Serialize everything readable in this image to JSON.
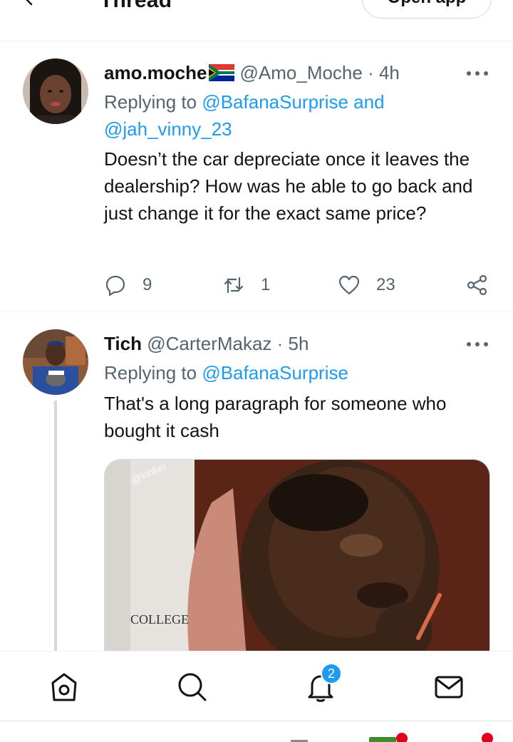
{
  "header": {
    "title": "Thread",
    "open_app_label": "Open app"
  },
  "tweets": [
    {
      "display_name": "amo.moche",
      "handle": "@Amo_Moche · 4h",
      "reply_prefix": "Replying to",
      "reply_mentions": "@BafanaSurprise and @jah_vinny_23",
      "text": "Doesn’t the car depreciate once it leaves the dealership? How was he able to go back and just change it for the exact same price?",
      "replies": "9",
      "retweets": "1",
      "likes": "23"
    },
    {
      "display_name": "Tich",
      "handle": "@CarterMakaz · 5h",
      "reply_prefix": "Replying to",
      "reply_mentions": "@BafanaSurprise",
      "text": "That's a long paragraph for someone who bought it cash",
      "media_watermark": "@innluu",
      "media_logo_text": "COLLEGE"
    }
  ],
  "bottom_nav": {
    "notification_count": "2"
  },
  "colors": {
    "accent": "#1d9bf0",
    "secondary_text": "#536471",
    "primary_text": "#0f1419",
    "divider": "#eff3f4"
  },
  "icons": [
    "back-arrow-icon",
    "south-africa-flag-icon",
    "more-icon",
    "reply-icon",
    "retweet-icon",
    "like-icon",
    "share-icon",
    "home-icon",
    "search-icon",
    "notifications-icon",
    "messages-icon"
  ]
}
